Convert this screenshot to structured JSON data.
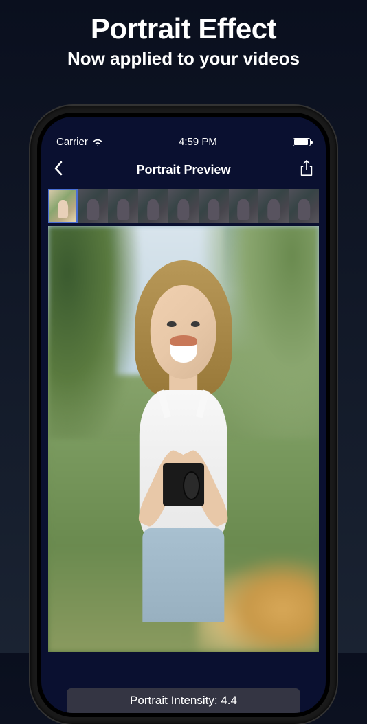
{
  "promo": {
    "title": "Portrait Effect",
    "subtitle": "Now applied to your videos"
  },
  "status": {
    "carrier": "Carrier",
    "time": "4:59 PM"
  },
  "nav": {
    "title": "Portrait Preview"
  },
  "intensity": {
    "label": "Portrait Intensity: 4.4"
  }
}
